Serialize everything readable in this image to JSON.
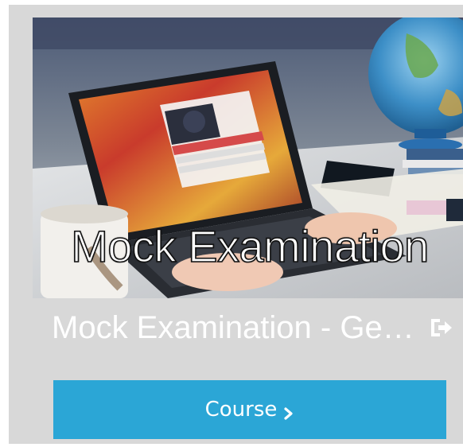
{
  "card": {
    "image_caption": "Mock Examination",
    "title": "Mock Examination - Gen...",
    "button_label": "Course",
    "exit_icon": "sign-out-icon",
    "chevron_icon": "chevron-right-icon"
  },
  "colors": {
    "card_background": "#d8d8d8",
    "button_background": "#2ba6d6",
    "text": "#ffffff"
  }
}
